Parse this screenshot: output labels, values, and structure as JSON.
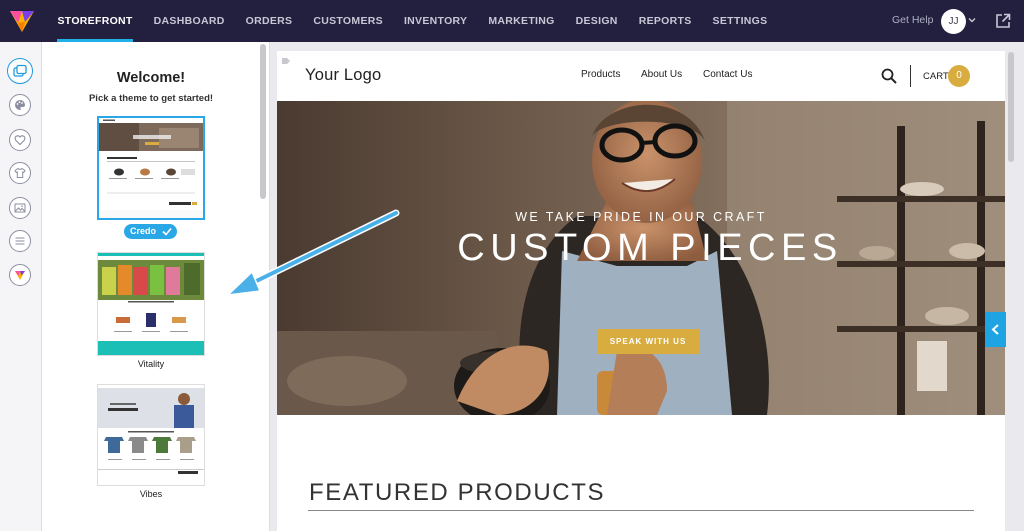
{
  "nav": {
    "items": [
      {
        "label": "STOREFRONT",
        "active": true
      },
      {
        "label": "DASHBOARD"
      },
      {
        "label": "ORDERS"
      },
      {
        "label": "CUSTOMERS"
      },
      {
        "label": "INVENTORY"
      },
      {
        "label": "MARKETING"
      },
      {
        "label": "DESIGN"
      },
      {
        "label": "REPORTS"
      },
      {
        "label": "SETTINGS"
      }
    ],
    "get_help": "Get Help",
    "avatar_initials": "JJ"
  },
  "rail": {
    "icons": [
      "themes-icon",
      "palette-icon",
      "heart-icon",
      "tshirt-icon",
      "image-icon",
      "menu-icon",
      "favicon-icon"
    ]
  },
  "panel": {
    "title": "Welcome!",
    "subtitle": "Pick a theme to get started!",
    "themes": [
      {
        "name": "Credo",
        "selected": true
      },
      {
        "name": "Vitality"
      },
      {
        "name": "Vibes"
      }
    ]
  },
  "preview": {
    "logo": "Your Logo",
    "links": [
      "Products",
      "About Us",
      "Contact Us"
    ],
    "cart_label": "CART",
    "cart_count": "0",
    "hero": {
      "eyebrow": "WE TAKE PRIDE IN OUR CRAFT",
      "title": "CUSTOM PIECES",
      "button": "SPEAK WITH US",
      "slides": 3,
      "active_slide": 2
    },
    "featured_title": "FEATURED PRODUCTS"
  },
  "colors": {
    "nav_bg": "#231f3f",
    "accent": "#2aa7e6",
    "gold": "#d8ac3f",
    "annotation_arrow": "#49b0e8"
  }
}
